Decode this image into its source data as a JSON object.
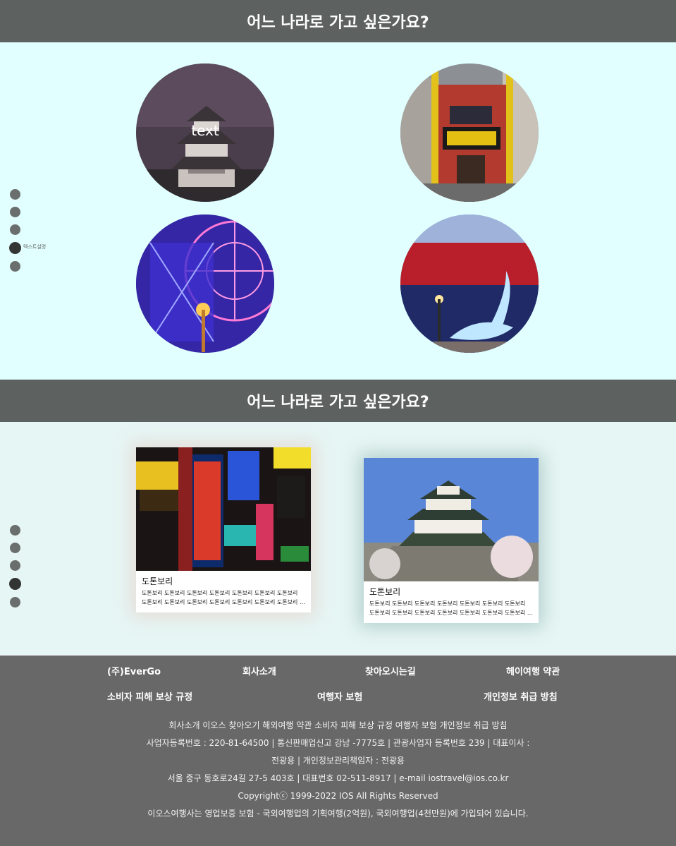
{
  "section1": {
    "title": "어느 나라로 가고 싶은가요?",
    "circle_caption": "text",
    "dots_tooltip": "텍스트설명"
  },
  "section2": {
    "title": "어느 나라로 가고 싶은가요?",
    "cards": [
      {
        "title": "도톤보리",
        "desc_line1": "도톤보리 도톤보리 도톤보리 도톤보리 도톤보리 도톤보리 도톤보리",
        "desc_line2": "도톤보리 도톤보리 도톤보리 도톤보리 도톤보리 도톤보리 도톤보리 도톤보..."
      },
      {
        "title": "도톤보리",
        "desc_line1": "도톤보리 도톤보리 도톤보리 도톤보리 도톤보리 도톤보리 도톤보리",
        "desc_line2": "도톤보리 도톤보리 도톤보리 도톤보리 도톤보리 도톤보리 도톤보리 도톤보..."
      }
    ]
  },
  "footer": {
    "links_row1": [
      "(주)EverGo",
      "회사소개",
      "찾아오시는길",
      "헤이여행 약관"
    ],
    "links_row2": [
      "소비자 피해 보상 규정",
      "여행자 보험",
      "개인정보 취급 방침"
    ],
    "info_lines": [
      "회사소개 이오스 찾아오기 해외여행 약관 소비자 피해 보상 규정 여행자 보험 개인정보 취급 방침",
      "사업자등록번호 : 220-81-64500 | 통신판매업신고 강남 -7775호 | 관광사업자 등록번호 239 | 대표이사 :",
      "전광용 | 개인정보관리책임자 : 전광용",
      "서울 중구 동호로24길 27-5 403호 | 대표번호 02-511-8917 | e-mail iostravel@ios.co.kr",
      "Copyrightⓒ 1999-2022 IOS All Rights Reserved",
      "이오스여행사는 영업보증 보험 - 국외여행업의 기획여행(2억원), 국외여행업(4천만원)에 가입되어 있습니다."
    ]
  },
  "colors": {
    "header_bg": "#5d6160",
    "section1_bg": "#e1ffff",
    "section2_bg": "#e6f6f4",
    "footer_bg": "#686868",
    "dot": "#6a6e6d",
    "dot_active": "#333535"
  }
}
